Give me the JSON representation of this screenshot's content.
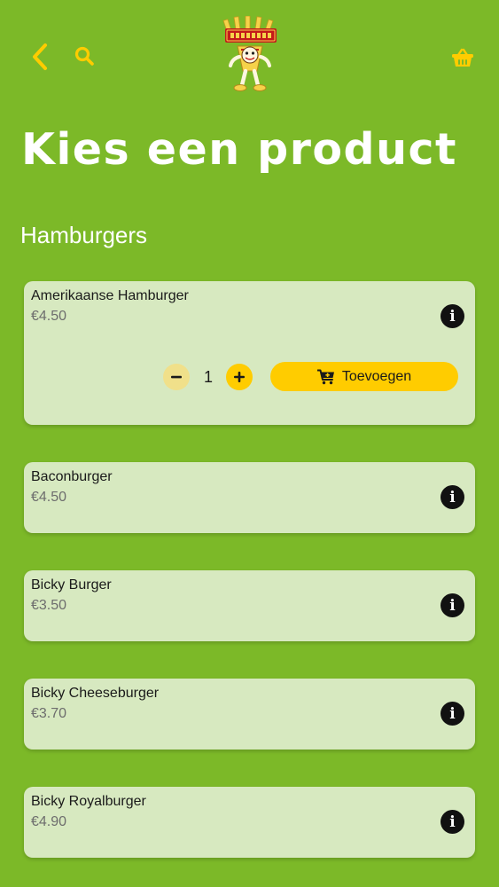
{
  "header": {
    "back_icon": "chevron-left-icon",
    "search_icon": "search-icon",
    "basket_icon": "shopping-basket-icon",
    "logo": "frituur-mascot-logo",
    "accent_color": "#ffcc00"
  },
  "page": {
    "title": "Kies een product",
    "background_color": "#7cb928"
  },
  "category": {
    "title": "Hamburgers"
  },
  "products": [
    {
      "name": "Amerikaanse Hamburger",
      "price": "€4.50",
      "expanded": true,
      "quantity": "1",
      "add_label": "Toevoegen"
    },
    {
      "name": "Baconburger",
      "price": "€4.50"
    },
    {
      "name": "Bicky Burger",
      "price": "€3.50"
    },
    {
      "name": "Bicky Cheeseburger",
      "price": "€3.70"
    },
    {
      "name": "Bicky Royalburger",
      "price": "€4.90"
    }
  ]
}
